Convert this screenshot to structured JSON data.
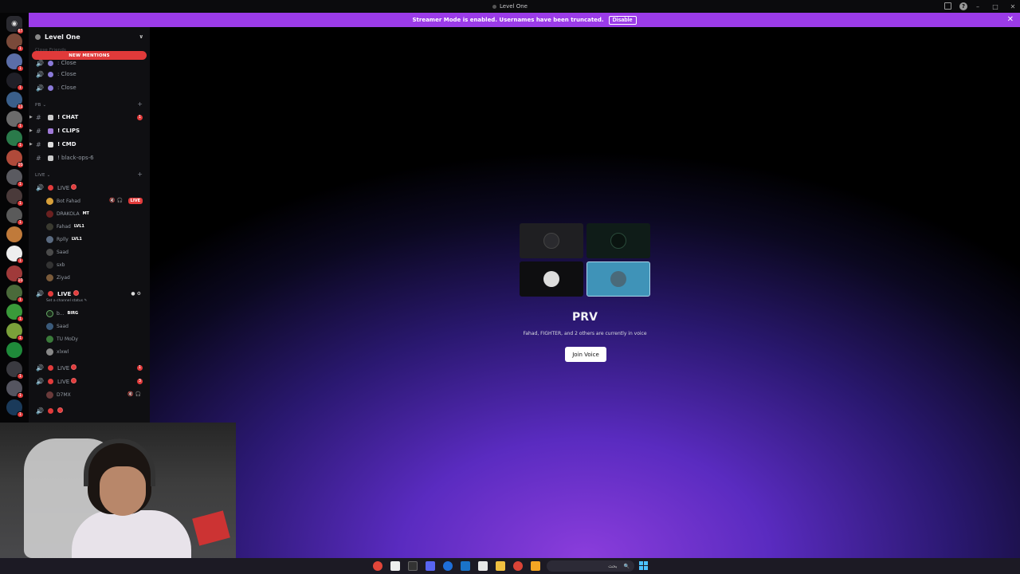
{
  "window": {
    "title": "Level One"
  },
  "banner": {
    "text": "Streamer Mode is enabled. Usernames have been truncated.",
    "disable_label": "Disable"
  },
  "rail": {
    "home_badge": "67",
    "servers": [
      {
        "badge": "1",
        "color": "#7a4a3a"
      },
      {
        "badge": "1",
        "color": "#5b6ea8"
      },
      {
        "badge": "1",
        "color": "#202028"
      },
      {
        "badge": "12",
        "color": "#3a5f8a"
      },
      {
        "badge": "1",
        "color": "#6b6b6b"
      },
      {
        "badge": "1",
        "color": "#2a7a4a"
      },
      {
        "badge": "10",
        "color": "#b04a3a"
      },
      {
        "badge": "1",
        "color": "#5a5a60"
      },
      {
        "badge": "1",
        "color": "#4a3a3a"
      },
      {
        "badge": "1",
        "color": "#5a5a5a"
      },
      {
        "badge": "",
        "color": "#c07a3a"
      },
      {
        "badge": "1",
        "color": "#eeeeee"
      },
      {
        "badge": "10",
        "color": "#a03a3a"
      },
      {
        "badge": "1",
        "color": "#4a6a3a"
      },
      {
        "badge": "1",
        "color": "#3a9a3a"
      },
      {
        "badge": "1",
        "color": "#7aa03a"
      },
      {
        "badge": "",
        "color": "#1f8a3a"
      },
      {
        "badge": "1",
        "color": "#3a3a40"
      },
      {
        "badge": "1",
        "color": "#555560"
      },
      {
        "badge": "1",
        "color": "#1a3a5a"
      }
    ]
  },
  "sidebar": {
    "server_name": "Level One",
    "new_mentions": "NEW MENTIONS",
    "partial_category": "Close Friends",
    "close_channels": [
      ": Close",
      ": Close",
      ": Close"
    ],
    "category_pb": "PB",
    "text_channels": [
      {
        "label": "! CHAT",
        "badge": "1",
        "bold": true
      },
      {
        "label": "! CLIPS",
        "badge": "",
        "bold": true
      },
      {
        "label": "! CMD",
        "badge": "",
        "bold": true
      },
      {
        "label": "! black-ops-6",
        "badge": "",
        "bold": false
      }
    ],
    "category_live": "LIVE",
    "voice1": {
      "label": "LIVE",
      "users": [
        {
          "name": "Bot Fahad",
          "tag": "",
          "live": "LIVE"
        },
        {
          "name": "DRAKOLA",
          "tag": "MT",
          "live": ""
        },
        {
          "name": "Fahad",
          "tag": "LVL1",
          "live": ""
        },
        {
          "name": "Rplly",
          "tag": "LVL1",
          "live": ""
        },
        {
          "name": "Saad",
          "tag": "",
          "live": ""
        },
        {
          "name": "sxb",
          "tag": "",
          "live": ""
        },
        {
          "name": "Ziyad",
          "tag": "",
          "live": ""
        }
      ]
    },
    "voice2": {
      "label": "LIVE",
      "status": "Set a channel status",
      "users": [
        {
          "name": "b...",
          "tag": "BIRG"
        },
        {
          "name": "Saad",
          "tag": ""
        },
        {
          "name": "TU MoDy",
          "tag": ""
        },
        {
          "name": "xlxwl",
          "tag": ""
        }
      ]
    },
    "voice3": {
      "label": "LIVE",
      "badge": "1"
    },
    "voice4": {
      "label": "LIVE",
      "badge": "3",
      "user": "D7MX"
    }
  },
  "main": {
    "channel_name": "PRV",
    "subtitle": "Fahad, FIGHTER, and 2 others are currently in voice",
    "join_label": "Join Voice"
  },
  "taskbar": {
    "search_text": "بحث"
  }
}
